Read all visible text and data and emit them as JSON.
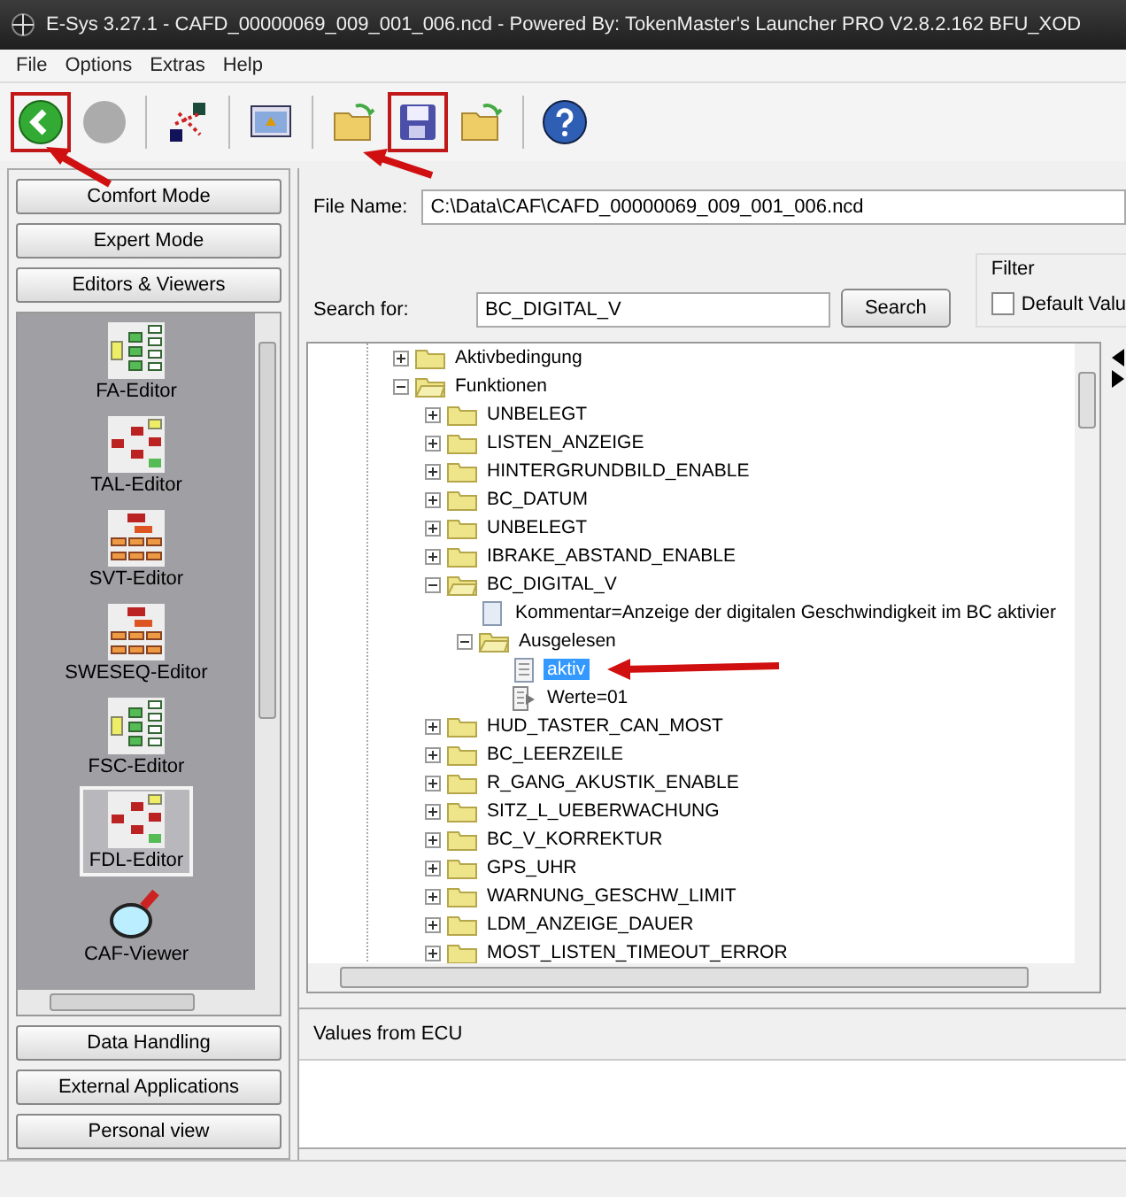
{
  "window": {
    "title": "E-Sys 3.27.1 - CAFD_00000069_009_001_006.ncd   - Powered By: TokenMaster's Launcher PRO V2.8.2.162 BFU_XOD"
  },
  "menu": [
    "File",
    "Options",
    "Extras",
    "Help"
  ],
  "toolbar": [
    {
      "kind": "back",
      "disabled": false,
      "highlighted": true
    },
    {
      "kind": "stop",
      "disabled": true,
      "highlighted": false
    },
    {
      "kind": "connect",
      "disabled": false,
      "highlighted": false
    },
    {
      "kind": "monitor",
      "disabled": false,
      "highlighted": false
    },
    {
      "kind": "open",
      "disabled": false,
      "highlighted": false
    },
    {
      "kind": "save",
      "disabled": false,
      "highlighted": true
    },
    {
      "kind": "open",
      "disabled": false,
      "highlighted": false
    },
    {
      "kind": "help",
      "disabled": false,
      "highlighted": false
    }
  ],
  "sidebar": {
    "top_buttons": [
      "Comfort Mode",
      "Expert Mode",
      "Editors & Viewers"
    ],
    "tools": [
      {
        "label": "FA-Editor",
        "kind": "green-tree",
        "selected": false
      },
      {
        "label": "TAL-Editor",
        "kind": "red-tree",
        "selected": false
      },
      {
        "label": "SVT-Editor",
        "kind": "org-chart",
        "selected": false
      },
      {
        "label": "SWESEQ-Editor",
        "kind": "org-chart",
        "selected": false
      },
      {
        "label": "FSC-Editor",
        "kind": "green-tree",
        "selected": false
      },
      {
        "label": "FDL-Editor",
        "kind": "red-tree",
        "selected": true
      },
      {
        "label": "CAF-Viewer",
        "kind": "magnifier",
        "selected": false
      }
    ],
    "bottom_buttons": [
      "Data Handling",
      "External Applications",
      "Personal view"
    ]
  },
  "file_name": {
    "label": "File Name:",
    "value": "C:\\Data\\CAF\\CAFD_00000069_009_001_006.ncd"
  },
  "search": {
    "label": "Search for:",
    "value": "BC_DIGITAL_V",
    "button": "Search"
  },
  "filter": {
    "title": "Filter",
    "checkbox_label": "Default Valu",
    "checked": false
  },
  "tree": [
    {
      "label": "Aktivbedingung",
      "kind": "folder",
      "expanded": false,
      "selected": false
    },
    {
      "label": "Funktionen",
      "kind": "folder",
      "expanded": true,
      "selected": false,
      "children": [
        {
          "label": "UNBELEGT",
          "kind": "folder",
          "expanded": false,
          "selected": false
        },
        {
          "label": "LISTEN_ANZEIGE",
          "kind": "folder",
          "expanded": false,
          "selected": false
        },
        {
          "label": "HINTERGRUNDBILD_ENABLE",
          "kind": "folder",
          "expanded": false,
          "selected": false
        },
        {
          "label": "BC_DATUM",
          "kind": "folder",
          "expanded": false,
          "selected": false
        },
        {
          "label": "UNBELEGT",
          "kind": "folder",
          "expanded": false,
          "selected": false
        },
        {
          "label": "IBRAKE_ABSTAND_ENABLE",
          "kind": "folder",
          "expanded": false,
          "selected": false
        },
        {
          "label": "BC_DIGITAL_V",
          "kind": "folder",
          "expanded": true,
          "selected": false,
          "children": [
            {
              "label": "Kommentar=Anzeige der digitalen Geschwindigkeit im BC aktivier",
              "kind": "comment",
              "selected": false
            },
            {
              "label": "Ausgelesen",
              "kind": "folder",
              "expanded": true,
              "selected": false,
              "children": [
                {
                  "label": "aktiv",
                  "kind": "document",
                  "selected": true
                },
                {
                  "label": "Werte=01",
                  "kind": "value",
                  "selected": false
                }
              ]
            }
          ]
        },
        {
          "label": "HUD_TASTER_CAN_MOST",
          "kind": "folder",
          "expanded": false,
          "selected": false
        },
        {
          "label": "BC_LEERZEILE",
          "kind": "folder",
          "expanded": false,
          "selected": false
        },
        {
          "label": "R_GANG_AKUSTIK_ENABLE",
          "kind": "folder",
          "expanded": false,
          "selected": false
        },
        {
          "label": "SITZ_L_UEBERWACHUNG",
          "kind": "folder",
          "expanded": false,
          "selected": false
        },
        {
          "label": "BC_V_KORREKTUR",
          "kind": "folder",
          "expanded": false,
          "selected": false
        },
        {
          "label": "GPS_UHR",
          "kind": "folder",
          "expanded": false,
          "selected": false
        },
        {
          "label": "WARNUNG_GESCHW_LIMIT",
          "kind": "folder",
          "expanded": false,
          "selected": false
        },
        {
          "label": "LDM_ANZEIGE_DAUER",
          "kind": "folder",
          "expanded": false,
          "selected": false
        },
        {
          "label": "MOST_LISTEN_TIMEOUT_ERROR",
          "kind": "folder",
          "expanded": false,
          "selected": false
        }
      ]
    }
  ],
  "values_panel": {
    "title": "Values from ECU"
  }
}
